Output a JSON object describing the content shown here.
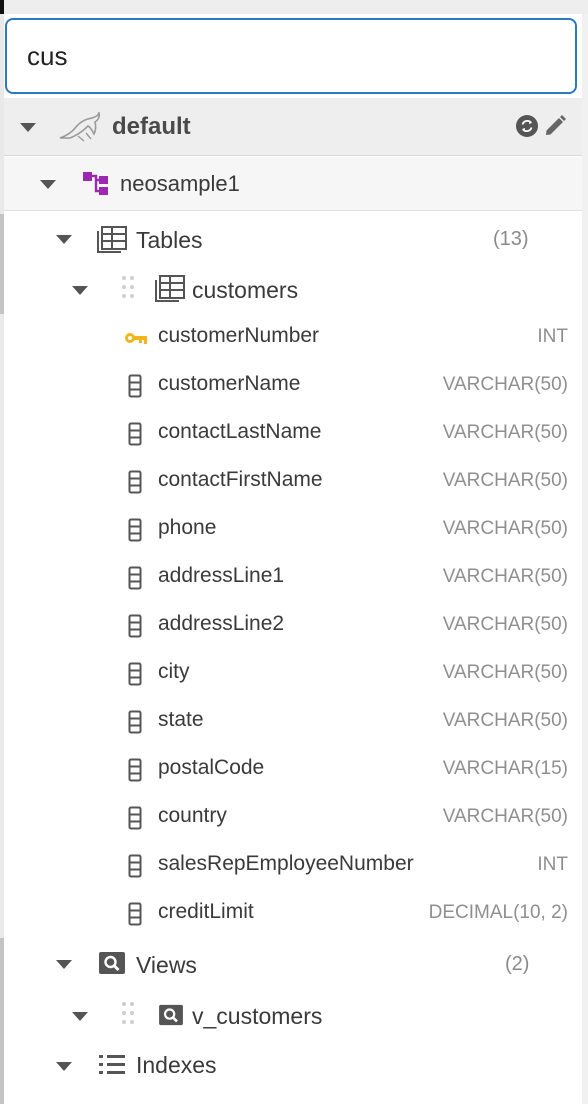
{
  "search": {
    "value": "cus"
  },
  "connection": {
    "label": "default",
    "refresh_icon": "refresh-icon",
    "edit_icon": "pencil-icon",
    "db_icon": "mysql-dolphin-icon"
  },
  "schema": {
    "label": "neosample1",
    "icon": "schema-icon",
    "color": "#9c27b0"
  },
  "tables_group": {
    "label": "Tables",
    "count": "(13)"
  },
  "table": {
    "label": "customers"
  },
  "columns": [
    {
      "name": "customerNumber",
      "type": "INT",
      "key": true
    },
    {
      "name": "customerName",
      "type": "VARCHAR(50)"
    },
    {
      "name": "contactLastName",
      "type": "VARCHAR(50)"
    },
    {
      "name": "contactFirstName",
      "type": "VARCHAR(50)"
    },
    {
      "name": "phone",
      "type": "VARCHAR(50)"
    },
    {
      "name": "addressLine1",
      "type": "VARCHAR(50)"
    },
    {
      "name": "addressLine2",
      "type": "VARCHAR(50)"
    },
    {
      "name": "city",
      "type": "VARCHAR(50)"
    },
    {
      "name": "state",
      "type": "VARCHAR(50)"
    },
    {
      "name": "postalCode",
      "type": "VARCHAR(15)"
    },
    {
      "name": "country",
      "type": "VARCHAR(50)"
    },
    {
      "name": "salesRepEmployeeNumber",
      "type": "INT"
    },
    {
      "name": "creditLimit",
      "type": "DECIMAL(10, 2)"
    }
  ],
  "views_group": {
    "label": "Views",
    "count": "(2)"
  },
  "view": {
    "label": "v_customers"
  },
  "indexes_group": {
    "label": "Indexes"
  },
  "colors": {
    "accent": "#2b79c2",
    "key": "#f2b51d"
  }
}
